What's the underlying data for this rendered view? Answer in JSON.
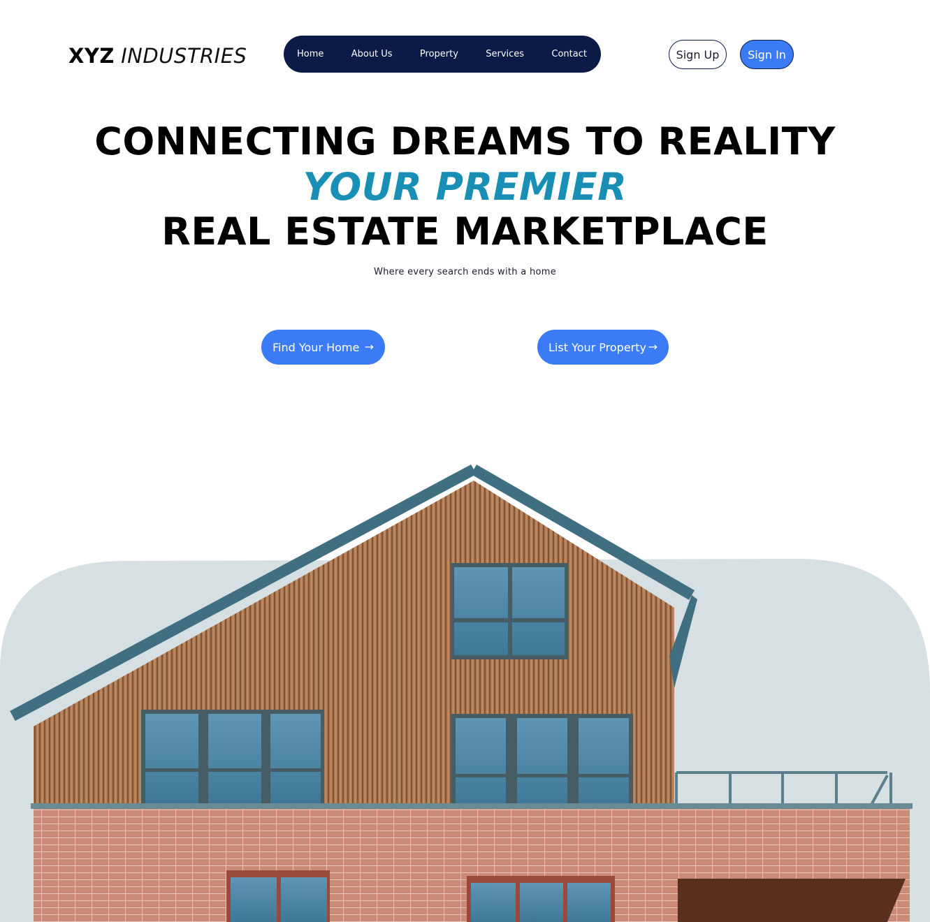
{
  "brand": {
    "name_bold": "XYZ",
    "name_light": "INDUSTRIES"
  },
  "nav": {
    "items": [
      {
        "label": "Home"
      },
      {
        "label": "About Us"
      },
      {
        "label": "Property"
      },
      {
        "label": "Services"
      },
      {
        "label": "Contact"
      }
    ]
  },
  "auth": {
    "sign_up": "Sign Up",
    "sign_in": "Sign In"
  },
  "hero": {
    "line1": "CONNECTING DREAMS TO REALITY",
    "line2": "YOUR PREMIER",
    "line3": "REAL ESTATE MARKETPLACE",
    "subtitle": "Where every search ends with a home"
  },
  "cta": {
    "find_home": "Find Your Home",
    "list_property": "List Your Property",
    "arrow_icon": "arrow-right-icon"
  },
  "colors": {
    "nav_bg": "#0b1a47",
    "accent_blue": "#3b7bf6",
    "highlight_teal": "#1a8fb5",
    "image_backdrop": "#d6e0e3"
  }
}
